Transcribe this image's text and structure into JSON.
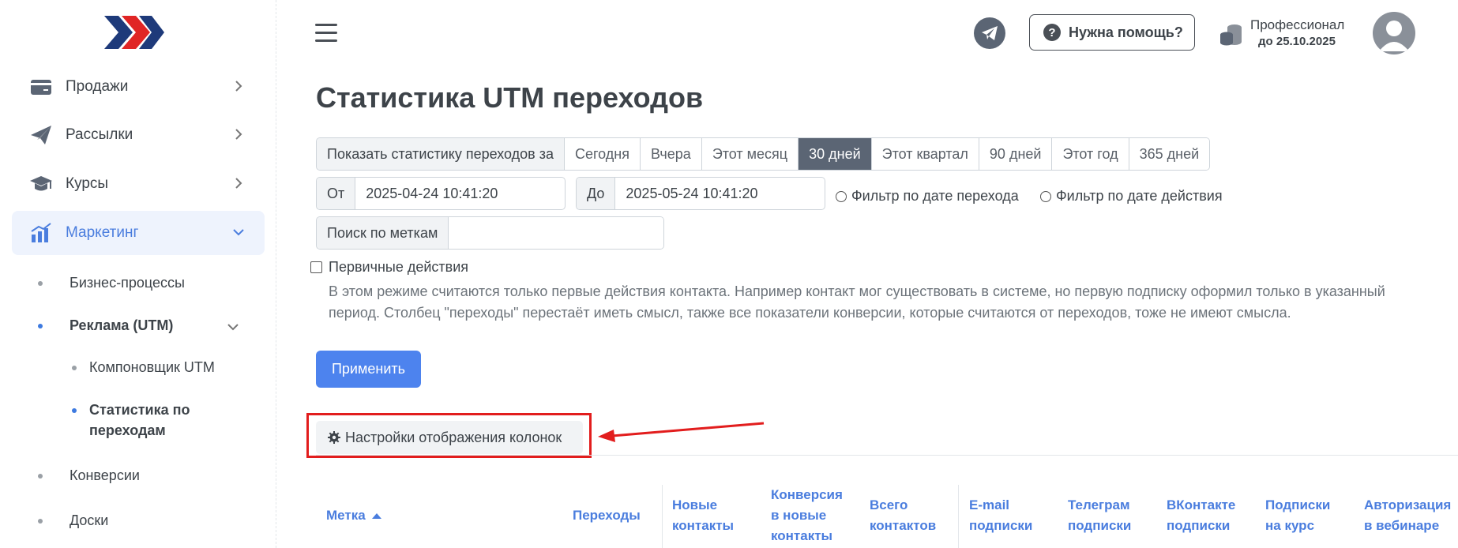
{
  "colors": {
    "accent": "#4d83ee",
    "active_period": "#5b6574",
    "highlight": "#e21d1d"
  },
  "sidebar": {
    "items": [
      {
        "label": "Продажи",
        "icon": "card-icon"
      },
      {
        "label": "Рассылки",
        "icon": "paper-plane-icon"
      },
      {
        "label": "Курсы",
        "icon": "graduation-cap-icon"
      },
      {
        "label": "Маркетинг",
        "icon": "chart-icon"
      }
    ],
    "sub": {
      "business": "Бизнес-процессы",
      "ads": "Реклама (UTM)",
      "builder": "Компоновщик UTM",
      "stats_line1": "Статистика по",
      "stats_line2": "переходам",
      "conversions": "Конверсии",
      "boards": "Доски"
    }
  },
  "header": {
    "help": "Нужна помощь?",
    "plan_name": "Профессионал",
    "plan_date": "до 25.10.2025"
  },
  "main": {
    "title": "Статистика UTM переходов",
    "period_prefix": "Показать статистику переходов за",
    "periods": [
      "Сегодня",
      "Вчера",
      "Этот месяц",
      "30 дней",
      "Этот квартал",
      "90 дней",
      "Этот год",
      "365 дней"
    ],
    "active_period": "30 дней",
    "from_label": "От",
    "from_value": "2025-04-24 10:41:20",
    "to_label": "До",
    "to_value": "2025-05-24 10:41:20",
    "radio1": "Фильтр по дате перехода",
    "radio2": "Фильтр по дате действия",
    "search_label": "Поиск по меткам",
    "search_value": "",
    "checkbox_label": "Первичные действия",
    "description": "В этом режиме считаются только первые действия контакта. Например контакт мог существовать в системе, но первую подписку оформил только в указанный период. Столбец \"переходы\" перестаёт иметь смысл, также все показатели конверсии, которые считаются от переходов, тоже не имеют смысла.",
    "apply": "Применить",
    "columns_settings": "Настройки отображения колонок"
  },
  "table": {
    "headers": {
      "tag": "Метка",
      "clicks": "Переходы",
      "new_contacts": "Новые контакты",
      "conversion": "Конверсия в новые контакты",
      "total_contacts": "Всего контактов",
      "email_subs": "E-mail подписки",
      "telegram_subs": "Телеграм подписки",
      "vk_subs": "ВКонтакте подписки",
      "course_subs": "Подписки на курс",
      "webinar_auth": "Авторизация в вебинаре"
    }
  }
}
